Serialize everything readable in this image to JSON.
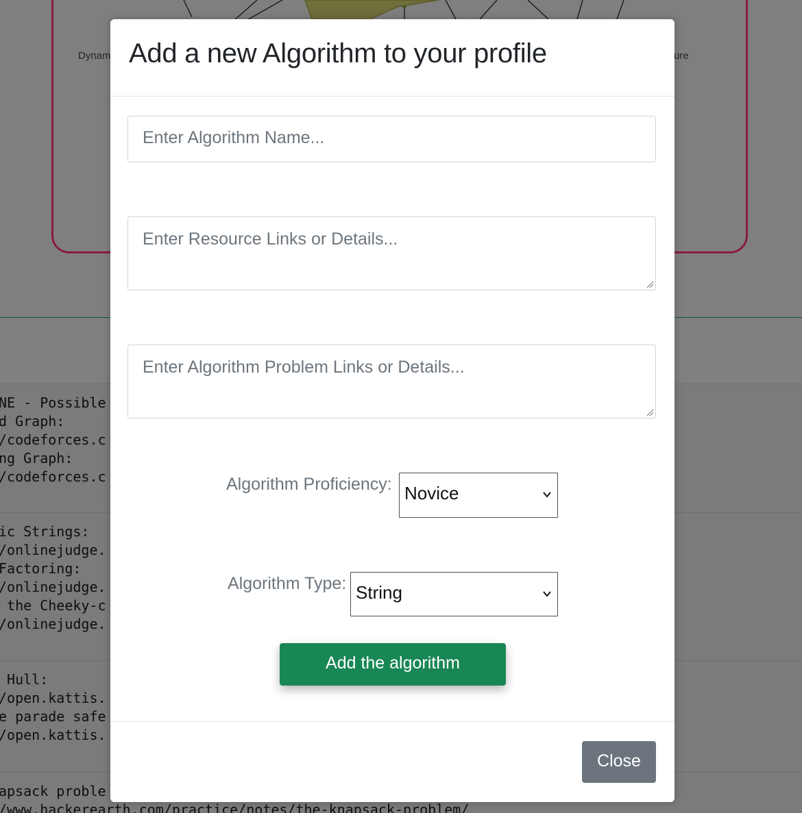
{
  "background": {
    "radar_labels": {
      "left": "Dynam",
      "right": "ure"
    },
    "code_blocks": [
      {
        "lines": [
          "NE - Possible",
          "d Graph:",
          "/codeforces.c",
          "ng Graph:",
          "/codeforces.c"
        ]
      },
      {
        "lines": [
          "ic Strings:",
          "/onlinejudge.",
          "Factoring:",
          "/onlinejudge.",
          " the Cheeky-c",
          "/onlinejudge."
        ]
      },
      {
        "lines": [
          " Hull:",
          "/open.kattis.",
          "e parade safe",
          "/open.kattis."
        ]
      },
      {
        "lines": [
          "apsack proble",
          "/www.hackerearth.com/practice/notes/the-knapsack-problem/"
        ]
      }
    ]
  },
  "modal": {
    "title": "Add a new Algorithm to your profile",
    "name_input": {
      "placeholder": "Enter Algorithm Name...",
      "value": ""
    },
    "resources_textarea": {
      "placeholder": "Enter Resource Links or Details...",
      "value": ""
    },
    "problems_textarea": {
      "placeholder": "Enter Algorithm Problem Links or Details...",
      "value": ""
    },
    "proficiency": {
      "label": "Algorithm Proficiency:",
      "selected": "Novice"
    },
    "type": {
      "label": "Algorithm Type:",
      "selected": "String"
    },
    "submit_label": "Add the algorithm",
    "close_label": "Close"
  },
  "colors": {
    "submit": "#198754",
    "close": "#6c757d",
    "chart_border": "#8a1a46",
    "placeholder": "#6c757d"
  }
}
